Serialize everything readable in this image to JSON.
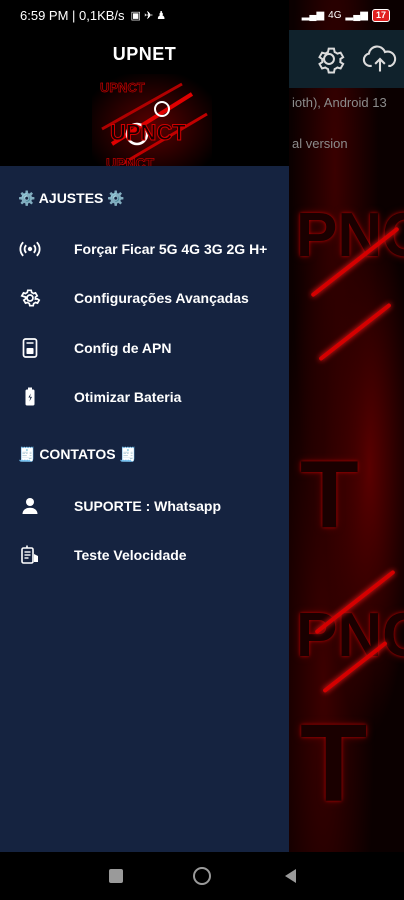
{
  "status_bar": {
    "time_speed": "6:59 PM | 0,1KB/s",
    "signal": "4G",
    "battery": "17"
  },
  "background_app": {
    "text_line1": "ioth), Android 13",
    "text_line2": "al version",
    "settings_icon": "gear-icon",
    "upload_icon": "cloud-upload-icon"
  },
  "drawer": {
    "title": "UPNET",
    "sections": {
      "settings_header": "⚙️ AJUSTES ⚙️",
      "contacts_header": "🧾 CONTATOS 🧾"
    },
    "items": [
      {
        "label": "Forçar Ficar 5G 4G 3G 2G H+",
        "icon": "broadcast-icon"
      },
      {
        "label": "Configurações Avançadas",
        "icon": "gear-icon"
      },
      {
        "label": "Config de APN",
        "icon": "sim-card-icon"
      },
      {
        "label": "Otimizar Bateria",
        "icon": "battery-icon"
      },
      {
        "label": "SUPORTE : Whatsapp",
        "icon": "person-icon"
      },
      {
        "label": "Teste Velocidade",
        "icon": "speedtest-icon"
      }
    ]
  },
  "nav_bar": {
    "recents": "square-icon",
    "home": "circle-icon",
    "back": "triangle-back-icon"
  },
  "colors": {
    "drawer_bg": "#152340",
    "accent_red": "#d40000",
    "topbar_bg": "#10222c"
  }
}
